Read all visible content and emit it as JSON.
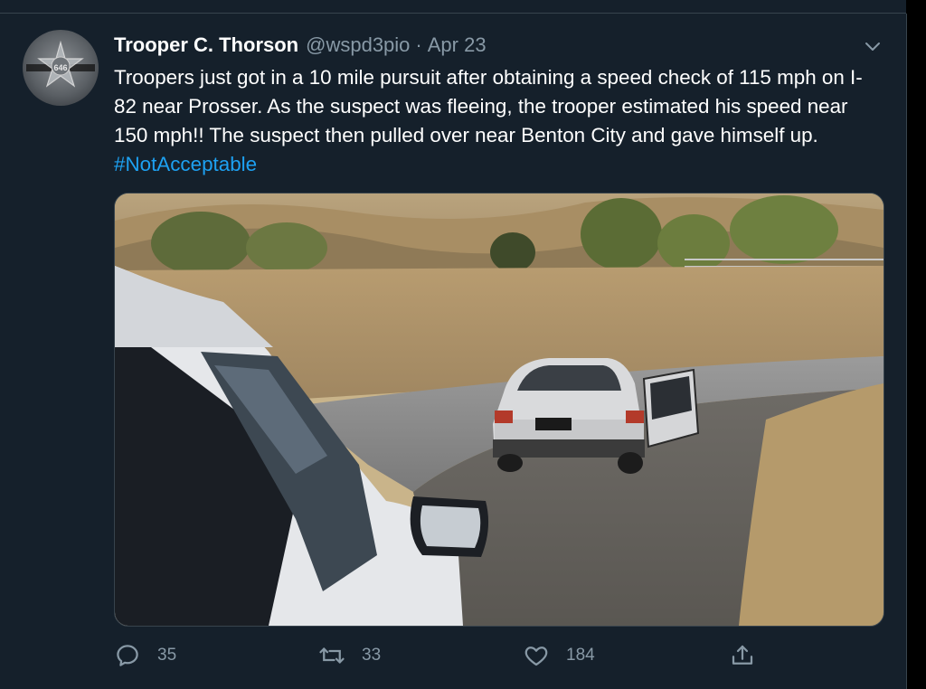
{
  "tweet": {
    "author_name": "Trooper C. Thorson",
    "handle": "@wspd3pio",
    "separator": "·",
    "date": "Apr 23",
    "avatar_badge_number": "646",
    "text": "Troopers just got in a 10 mile pursuit after obtaining a speed check of 115 mph on I-82 near Prosser. As the suspect was fleeing, the trooper estimated his speed near 150 mph!! The suspect then pulled over near Benton City and gave himself up.",
    "hashtag": "#NotAcceptable",
    "media_icon_name": "photo-of-stopped-car"
  },
  "actions": {
    "reply_count": "35",
    "retweet_count": "33",
    "like_count": "184",
    "reply_icon": "reply-icon",
    "retweet_icon": "retweet-icon",
    "like_icon": "heart-icon",
    "share_icon": "share-icon"
  },
  "colors": {
    "background": "#15202b",
    "text": "#ffffff",
    "secondary": "#8899a6",
    "link": "#1da1f2"
  }
}
